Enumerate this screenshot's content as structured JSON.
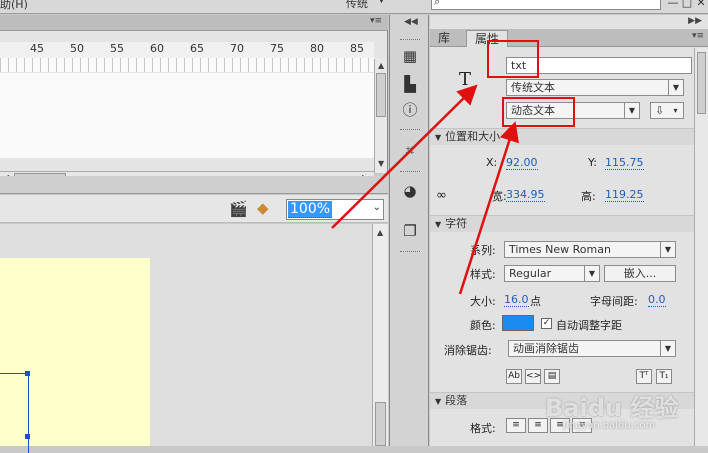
{
  "topbar": {
    "menu_tail": "助(H)",
    "workspace": "传统",
    "search_icon": "magnifier-icon",
    "window_minimize": "—",
    "window_restore": "□",
    "window_close": "✕"
  },
  "timeline": {
    "ruler_numbers": [
      "45",
      "50",
      "55",
      "60",
      "65",
      "70",
      "75",
      "80",
      "85"
    ]
  },
  "stage": {
    "zoom_value": "100%"
  },
  "toolstrip": {
    "tools": [
      "swatches-grid-icon",
      "align-icon",
      "info-icon",
      "transform-icon",
      "color-icon",
      "components-icon"
    ]
  },
  "properties": {
    "tabs": [
      "库",
      "属性"
    ],
    "active_tab": "属性",
    "instance_name": "txt",
    "text_engine": "传统文本",
    "text_type": "动态文本",
    "position_section": "位置和大小",
    "x_label": "X:",
    "x_value": "92.00",
    "y_label": "Y:",
    "y_value": "115.75",
    "w_label": "宽:",
    "w_value": "334.95",
    "h_label": "高:",
    "h_value": "119.25",
    "char_section": "字符",
    "family_label": "系列:",
    "family_value": "Times New Roman",
    "style_label": "样式:",
    "style_value": "Regular",
    "embed_button": "嵌入...",
    "size_label": "大小:",
    "size_value": "16.0",
    "size_unit": "点",
    "letter_spacing_label": "字母间距:",
    "letter_spacing_value": "0.0",
    "color_label": "颜色:",
    "text_color": "#1a8cf0",
    "auto_kern_label": "自动调整字距",
    "antialias_label": "消除锯齿:",
    "antialias_value": "动画消除锯齿",
    "paragraph_section": "段落",
    "format_label": "格式:"
  },
  "watermark": {
    "text": "Baidu 经验",
    "sub": "jingyan.baidu.com"
  },
  "colors": {
    "annotation_red": "#e01010",
    "selection_blue": "#1a4fd6",
    "stage_yellow": "#ffffcc"
  }
}
